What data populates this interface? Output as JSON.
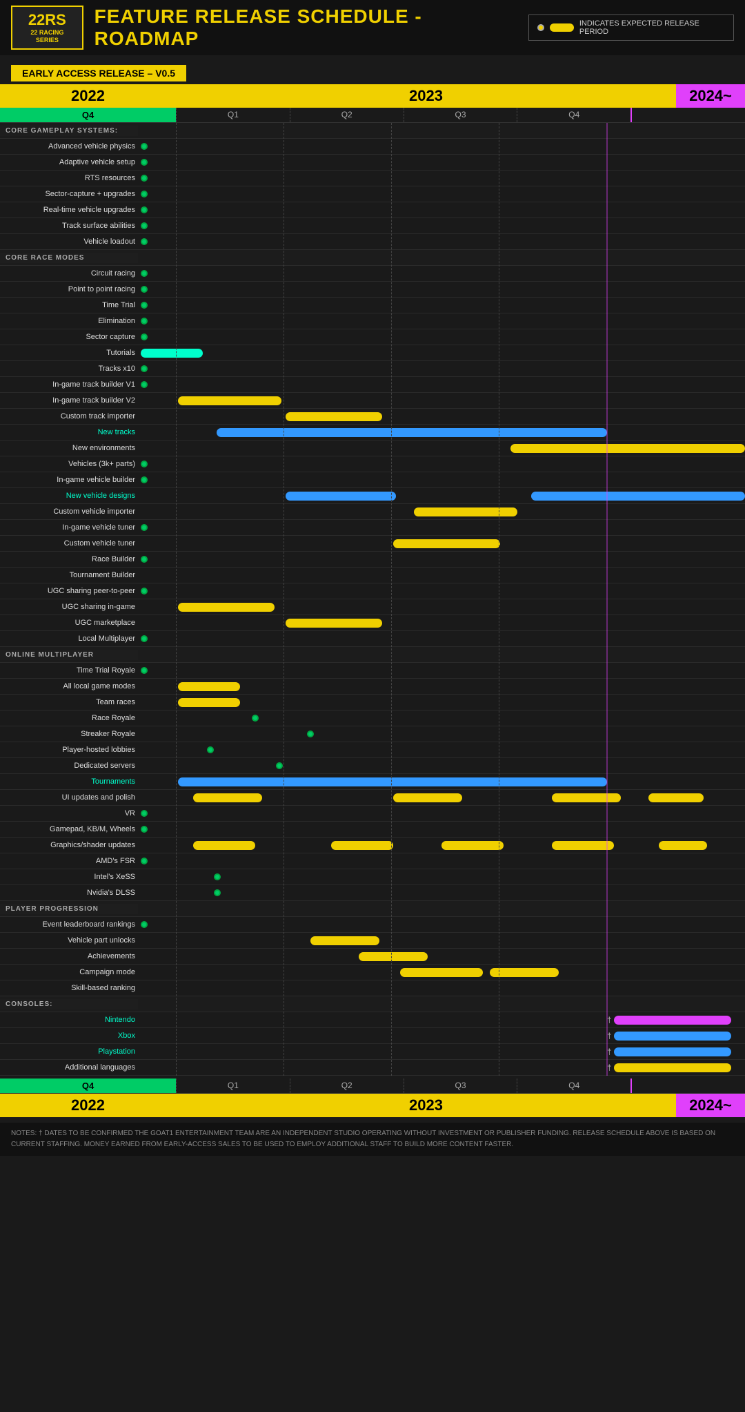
{
  "header": {
    "logo_line1": "22RS",
    "logo_line2": "22 RACING SERIES",
    "title": "FEATURE RELEASE SCHEDULE - ROADMAP",
    "legend_text": "INDICATES EXPECTED RELEASE PERIOD"
  },
  "early_access": "EARLY ACCESS RELEASE – V0.5",
  "years": {
    "y2022": "2022",
    "y2023": "2023",
    "y2024": "2024~"
  },
  "quarters": {
    "q4": "Q4",
    "q1": "Q1",
    "q2": "Q2",
    "q3": "Q3",
    "q4b": "Q4"
  },
  "notes": "NOTES: † DATES TO BE CONFIRMED\nTHE GOAT1 ENTERTAINMENT TEAM ARE AN INDEPENDENT STUDIO OPERATING WITHOUT INVESTMENT OR PUBLISHER FUNDING. RELEASE SCHEDULE ABOVE IS BASED ON CURRENT STAFFING.\nMONEY EARNED FROM EARLY-ACCESS SALES TO BE USED TO EMPLOY ADDITIONAL STAFF TO BUILD MORE CONTENT FASTER."
}
